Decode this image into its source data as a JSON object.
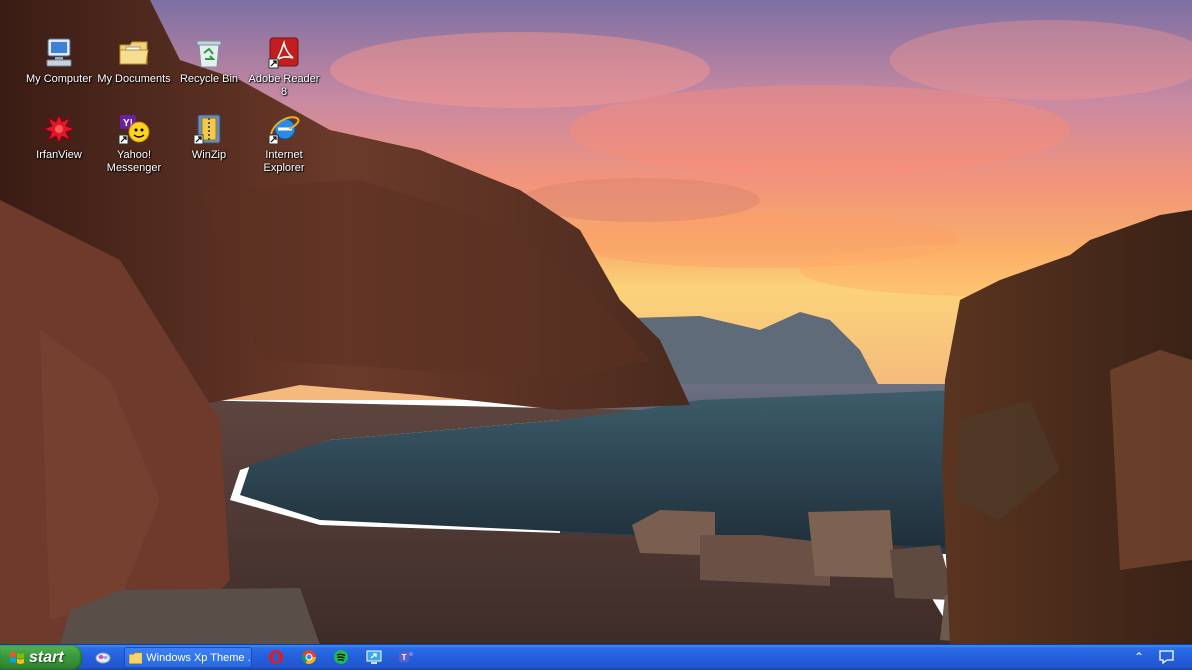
{
  "desktop": {
    "icons": [
      {
        "label": "My Computer"
      },
      {
        "label": "My Documents"
      },
      {
        "label": "Recycle Bin"
      },
      {
        "label": "Adobe Reader 8"
      },
      {
        "label": "IrfanView"
      },
      {
        "label": "Yahoo! Messenger"
      },
      {
        "label": "WinZip"
      },
      {
        "label": "Internet Explorer"
      }
    ]
  },
  "taskbar": {
    "start_label": "start",
    "window_button_label": "Windows Xp Theme ...",
    "colors": {
      "taskbar": "#245edb",
      "start": "#3b9b3d"
    }
  }
}
